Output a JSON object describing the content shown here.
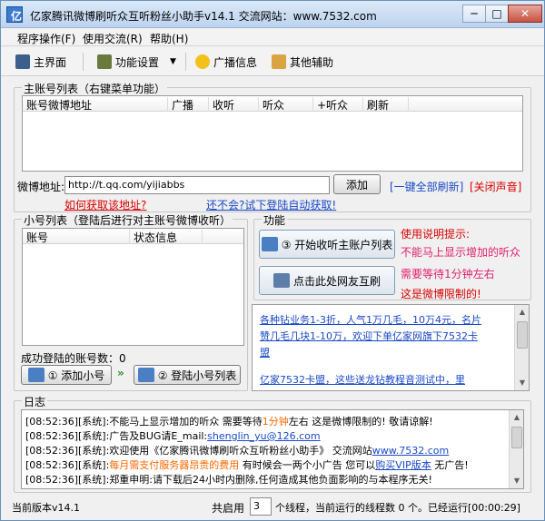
{
  "window": {
    "title": "亿家腾讯微博刷听众互听粉丝小助手v14.1   交流网站：www.7532.com",
    "min": "─",
    "max": "□",
    "close": "✕"
  },
  "menu": [
    "程序操作(F)",
    "使用交流(R)",
    "帮助(H)"
  ],
  "toolbar": {
    "main": "主界面",
    "func": "功能设置",
    "dropdown": "▼",
    "broadcast": "广播信息",
    "other": "其他辅助"
  },
  "main_accounts": {
    "legend": "主账号列表（右键菜单功能）",
    "columns": [
      "账号微博地址",
      "广播",
      "收听",
      "听众",
      "+听众",
      "刷新"
    ]
  },
  "weibo": {
    "label": "微博地址:",
    "value": "http://t.qq.com/yijiabbs",
    "add": "添加",
    "refresh_all": "[一键全部刷新]",
    "mute": "[关闭声音]",
    "how_link": "如何获取该地址?",
    "auto_link": "还不会?试下登陆自动获取!"
  },
  "sub_accounts": {
    "legend": "小号列表（登陆后进行对主账号微博收听）",
    "columns": [
      "账号",
      "状态信息"
    ],
    "success_label": "成功登陆的账号数：0",
    "add_btn": "① 添加小号",
    "arrows": "»",
    "login_btn": "② 登陆小号列表"
  },
  "func": {
    "legend": "功能",
    "start_btn": "③ 开始收听主账户列表",
    "net_btn": "点击此处网友互刷",
    "tips": [
      "使用说明提示:",
      "不能马上显示增加的听众",
      "需要等待1分钟左右",
      "这是微博限制的!"
    ]
  },
  "ad": {
    "line1": "各种钻业务1-3折，人气1万几毛，10万4元，名片",
    "line2": "赞几毛几块1-10万，欢迎下单亿家网旗下7532卡",
    "line3": "盟",
    "line4": "亿家7532卡盟，这些送龙钻教程音测试中，里"
  },
  "log": {
    "legend": "日志",
    "lines": [
      {
        "time": "[08:52:36]",
        "a": "[系统]:不能马上显示增加的听众 需要等待",
        "b": "1分钟",
        "c": "左右 这是微博限制的! 敬请谅解!"
      },
      {
        "time": "[08:52:36]",
        "a": "[系统]:广告及BUG请E_mail:",
        "b": "shenglin_yu@126.com",
        "c": ""
      },
      {
        "time": "[08:52:36]",
        "a": "[系统]:欢迎使用《亿家腾讯微博刷听众互听粉丝小助手》 交流网站",
        "b": "www.7532.com",
        "c": ""
      },
      {
        "time": "[08:52:36]",
        "a": "[系统]:",
        "b": "每月需支付服务器昂贵的费用",
        "c": " 有时候会一两个小广告 您可以",
        "d": "购买VIP版本",
        "e": " 无广告!"
      },
      {
        "time": "[08:52:36]",
        "a": "[系统]:郑重申明:请下载后24小时内删除,任何造成其他负面影响的与本程序无关!",
        "b": "",
        "c": ""
      }
    ]
  },
  "statusbar": {
    "version": "当前版本v14.1",
    "total_label": "共启用",
    "threads": "3",
    "rest": "个线程，当前运行的线程数 0 个。已经运行[00:00:29]"
  },
  "colors": {
    "red": "#d80000",
    "blue": "#1a49c8",
    "pink": "#e0206b",
    "orange": "#ff6600"
  }
}
